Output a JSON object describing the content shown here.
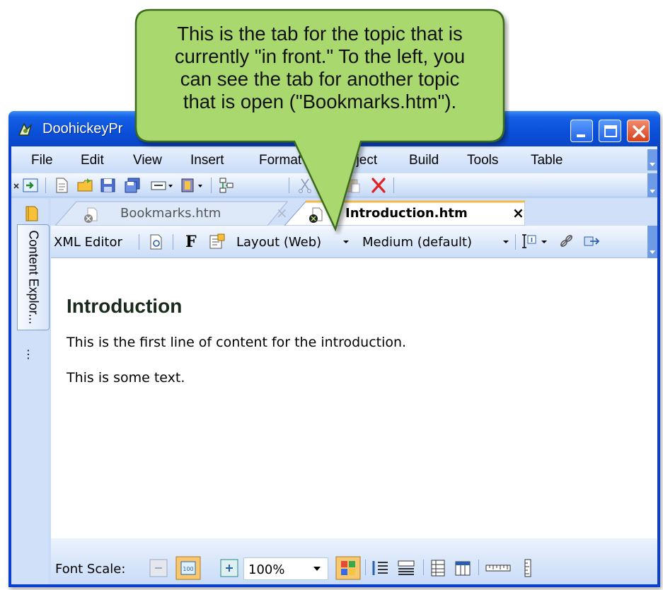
{
  "window": {
    "title": "DoohickeyPrompt - Madcap Flare",
    "title_visible": "DoohickeyPr"
  },
  "menu": {
    "items": [
      "File",
      "Edit",
      "View",
      "Insert",
      "Format",
      "Project",
      "Build",
      "Tools",
      "Table"
    ]
  },
  "side_panel": {
    "tab_label": "Content Explor...",
    "more": "⋮"
  },
  "tabs": [
    {
      "label": "Bookmarks.htm",
      "active": false
    },
    {
      "label": "Introduction.htm",
      "active": true
    }
  ],
  "tab_close": "×",
  "editor_toolbar": {
    "mode": "XML Editor",
    "font_button": "F",
    "layout": "Layout (Web)",
    "medium": "Medium (default)"
  },
  "document": {
    "heading": "Introduction",
    "lines": [
      "This is the first line of content for the introduction.",
      "This is some text."
    ]
  },
  "status": {
    "font_scale_label": "Font Scale:",
    "zoom": "100%"
  },
  "callout": {
    "lines": [
      "This is the tab for the topic that is",
      "currently \"in front.\" To the left, you",
      "can see the tab for another topic",
      "that is open (\"Bookmarks.htm\")."
    ]
  },
  "colors": {
    "titlebar": "#0a4fd8",
    "callout_fill": "#a9d86e",
    "callout_border": "#3a6a1e",
    "active_tab_accent": "#f5b94a"
  }
}
